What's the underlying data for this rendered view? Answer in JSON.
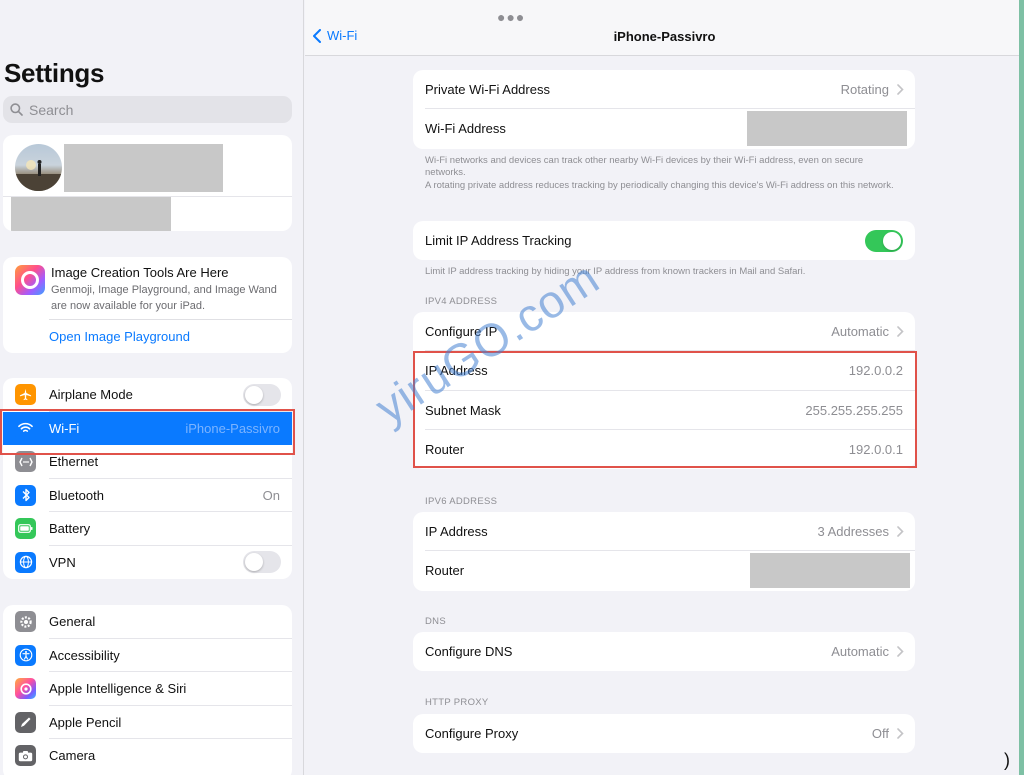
{
  "colors": {
    "accent": "#0a7aff",
    "toggle_on": "#34c759",
    "highlight_box": "#e0524a",
    "watermark": "#4682d2"
  },
  "sidebar": {
    "title": "Settings",
    "search": {
      "placeholder": "Search",
      "icon": "search-icon"
    },
    "promo": {
      "title": "Image Creation Tools Are Here",
      "body": "Genmoji, Image Playground, and Image Wand are now available for your iPad.",
      "link": "Open Image Playground"
    },
    "group1": [
      {
        "label": "Airplane Mode",
        "icon": "airplane-icon",
        "toggle": "off"
      },
      {
        "label": "Wi-Fi",
        "icon": "wifi-icon",
        "value": "iPhone-Passivro",
        "selected": true
      },
      {
        "label": "Ethernet",
        "icon": "ethernet-icon"
      },
      {
        "label": "Bluetooth",
        "icon": "bluetooth-icon",
        "value": "On"
      },
      {
        "label": "Battery",
        "icon": "battery-icon"
      },
      {
        "label": "VPN",
        "icon": "globe-icon",
        "toggle": "off"
      }
    ],
    "group2": [
      {
        "label": "General",
        "icon": "gear-icon"
      },
      {
        "label": "Accessibility",
        "icon": "accessibility-icon"
      },
      {
        "label": "Apple Intelligence & Siri",
        "icon": "siri-icon"
      },
      {
        "label": "Apple Pencil",
        "icon": "pencil-icon"
      },
      {
        "label": "Camera",
        "icon": "camera-icon"
      }
    ]
  },
  "detail": {
    "back_label": "Wi-Fi",
    "title": "iPhone-Passivro",
    "private": [
      {
        "label": "Private Wi-Fi Address",
        "value": "Rotating"
      },
      {
        "label": "Wi-Fi Address",
        "value": ""
      }
    ],
    "private_note": "Wi-Fi networks and devices can track other nearby Wi-Fi devices by their Wi-Fi address, even on secure networks.\nA rotating private address reduces tracking by periodically changing this device's Wi-Fi address on this network.",
    "limit_tracking": {
      "label": "Limit IP Address Tracking",
      "toggle": "on"
    },
    "limit_note": "Limit IP address tracking by hiding your IP address from known trackers in Mail and Safari.",
    "ipv4_header": "IPV4 ADDRESS",
    "ipv4": [
      {
        "label": "Configure IP",
        "value": "Automatic"
      },
      {
        "label": "IP Address",
        "value": "192.0.0.2"
      },
      {
        "label": "Subnet Mask",
        "value": "255.255.255.255"
      },
      {
        "label": "Router",
        "value": "192.0.0.1"
      }
    ],
    "ipv6_header": "IPV6 ADDRESS",
    "ipv6": [
      {
        "label": "IP Address",
        "value": "3 Addresses"
      },
      {
        "label": "Router",
        "value": ""
      }
    ],
    "dns_header": "DNS",
    "dns": {
      "label": "Configure DNS",
      "value": "Automatic"
    },
    "proxy_header": "HTTP PROXY",
    "proxy": {
      "label": "Configure Proxy",
      "value": "Off"
    }
  },
  "watermark": "yiruGO.com"
}
